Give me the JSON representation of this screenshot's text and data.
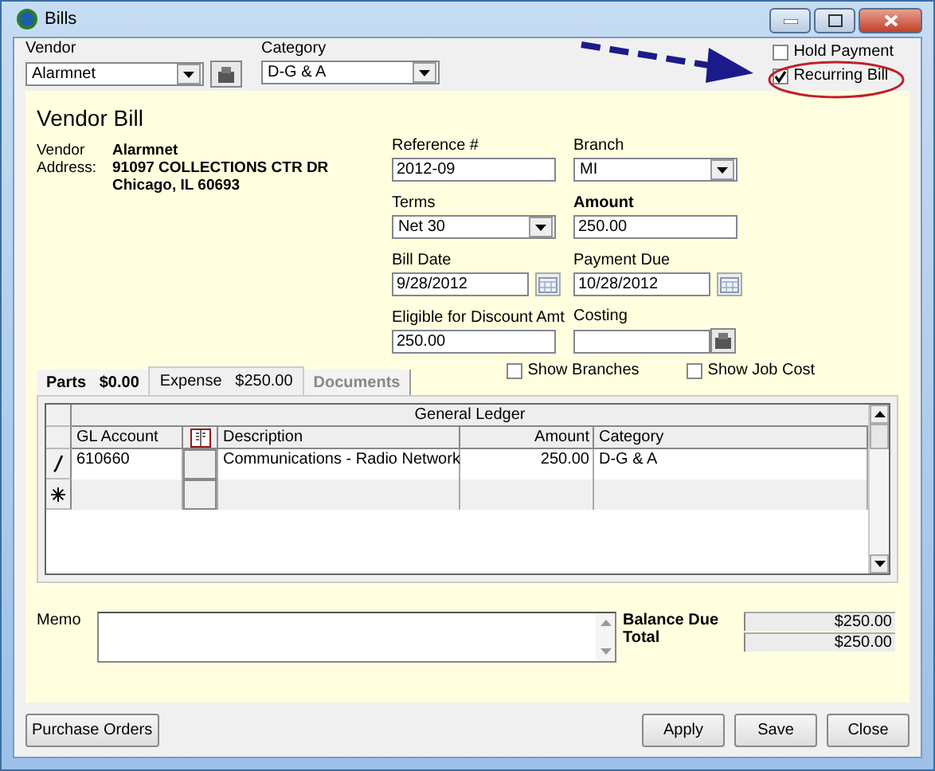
{
  "window": {
    "title": "Bills"
  },
  "vendor": {
    "label": "Vendor",
    "value": "Alarmnet"
  },
  "category": {
    "label": "Category",
    "value": "D-G & A"
  },
  "options": [
    {
      "label": "Hold Payment",
      "checked": false
    },
    {
      "label": "Recurring Bill",
      "checked": true
    }
  ],
  "panel": {
    "title": "Vendor Bill",
    "address_labels": [
      "Vendor",
      "Address:"
    ],
    "address_lines": [
      "Alarmnet",
      "91097 COLLECTIONS CTR DR",
      "Chicago, IL  60693"
    ]
  },
  "fields": [
    {
      "label": "Reference #",
      "kind": "text",
      "value": "2012-09",
      "emphasized": false
    },
    {
      "label": "Branch",
      "kind": "select",
      "value": "MI",
      "emphasized": false
    },
    {
      "label": "Terms",
      "kind": "select",
      "value": "Net 30",
      "emphasized": false
    },
    {
      "label": "Amount",
      "kind": "text",
      "value": "250.00",
      "emphasized": true
    },
    {
      "label": "Bill Date",
      "kind": "date",
      "value": "9/28/2012",
      "emphasized": false
    },
    {
      "label": "Payment Due",
      "kind": "date",
      "value": "10/28/2012",
      "emphasized": false
    },
    {
      "label": "Eligible for Discount Amt",
      "kind": "text",
      "value": "250.00",
      "emphasized": false
    },
    {
      "label": "Costing",
      "kind": "lookup",
      "emphasized": false
    }
  ],
  "tabs": [
    {
      "label": "Parts",
      "amount": "$0.00",
      "selected": false,
      "emphasized": true,
      "disabled": false
    },
    {
      "label": "Expense",
      "amount": "$250.00",
      "selected": true,
      "emphasized": false,
      "disabled": false
    },
    {
      "label": "Documents",
      "selected": false,
      "emphasized": true,
      "disabled": true
    }
  ],
  "toggles": [
    {
      "label": "Show Branches",
      "checked": false
    },
    {
      "label": "Show Job Cost",
      "checked": false
    }
  ],
  "table": {
    "group_header": "General Ledger",
    "columns": [
      "GL Account",
      "",
      "Description",
      "Amount",
      "Category"
    ],
    "rows": [
      {
        "kind": "edit",
        "cells": [
          "610660",
          "",
          "Communications - Radio Network",
          "250.00",
          "D-G & A"
        ]
      },
      {
        "kind": "new",
        "cells": [
          "",
          "",
          "",
          "",
          ""
        ]
      }
    ]
  },
  "memo": {
    "label": "Memo"
  },
  "totals": [
    {
      "label": "Balance Due",
      "value": "$250.00"
    },
    {
      "label": "Total",
      "value": "$250.00"
    }
  ],
  "buttons_left": [
    "Purchase Orders"
  ],
  "buttons_right": [
    "Apply",
    "Save",
    "Close"
  ]
}
